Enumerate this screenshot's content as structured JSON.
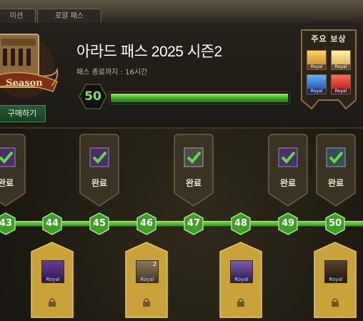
{
  "tabs": [
    {
      "label": "미션"
    },
    {
      "label": "로얄 패스"
    }
  ],
  "header": {
    "title": "아라드 패스 2025 시즌2",
    "end_label": "패스 종료까지 : 16시간",
    "level": "50",
    "progress_fraction": 1.0,
    "buy_button": "구매하기",
    "logo_text": "Season"
  },
  "rewards": {
    "title": "주요 보상",
    "items": [
      {
        "icon": "hand-chest-icon",
        "tag": "Royal"
      },
      {
        "icon": "plus10-ticket-icon",
        "tag": "Royal"
      },
      {
        "icon": "blue-beast-icon",
        "tag": "Royal"
      },
      {
        "icon": "red-box-icon",
        "tag": "Royal"
      }
    ]
  },
  "track": {
    "levels": [
      "43",
      "44",
      "45",
      "46",
      "47",
      "48",
      "49",
      "50"
    ],
    "free_rewards": [
      {
        "level": "43",
        "label": "완료",
        "icon": "check-icon",
        "tag": "BLANK"
      },
      {
        "level": "45",
        "label": "완료",
        "icon": "check-icon",
        "tag": "BLANK"
      },
      {
        "level": "47",
        "label": "완료",
        "icon": "check-icon",
        "tag": "BLANK"
      },
      {
        "level": "49",
        "label": "완료",
        "icon": "check-icon",
        "tag": "BLANK"
      },
      {
        "level": "50",
        "label": "완료",
        "icon": "check-icon",
        "tag": "BLANK"
      }
    ],
    "royal_rewards": [
      {
        "level": "44",
        "icon": "purple-weapon-icon",
        "tag": "Royal"
      },
      {
        "level": "46",
        "icon": "scroll-icon",
        "tag": "Royal",
        "count": "2"
      },
      {
        "level": "48",
        "icon": "purple-hammer-icon",
        "tag": "Royal"
      },
      {
        "level": "50",
        "icon": "dark-beast-icon",
        "tag": "Royal"
      }
    ]
  },
  "colors": {
    "accent_green": "#4fbf2a",
    "gold_card": "#c9a23a",
    "dark_card": "#3a3324",
    "node_green": "#3f9e25"
  }
}
